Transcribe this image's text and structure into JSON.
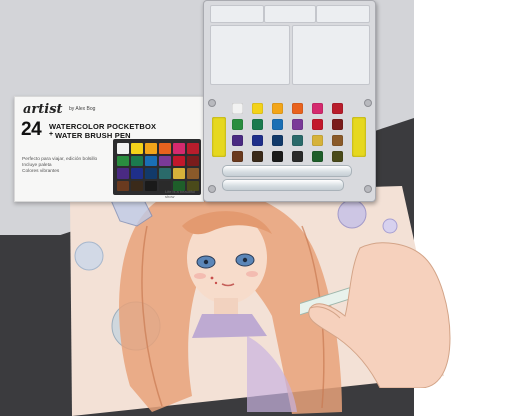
{
  "brand": {
    "logo_text": "artist",
    "byline": "by Alex Bog"
  },
  "product": {
    "count": "24",
    "title_line_1": "WATERCOLOR POCKETBOX",
    "plus": "+",
    "title_line_2": "WATER BRUSH PEN",
    "features": [
      "Perfecto para viajar, edición bolsillo",
      "Incluye paleta",
      "Colores vibrantes"
    ],
    "caption": "Life is a beautiful show"
  },
  "palette": {
    "pan_colors": [
      "#f2f2f2",
      "#f3d21a",
      "#f2a51a",
      "#e8621e",
      "#d42a6e",
      "#b81d2c",
      "#2a8d3f",
      "#1b7a4e",
      "#1a6fb5",
      "#7a3a98",
      "#c2182b",
      "#7a1c1c",
      "#4a2a82",
      "#1f2f8a",
      "#123a6a",
      "#2a6a6a",
      "#d6b23a",
      "#8a5a2a",
      "#6a3a1f",
      "#3a2a1a",
      "#1a1a1a",
      "#2a2a2a",
      "#1e5e2a",
      "#4a4a1a"
    ],
    "side_pan_color": "#e6d81f"
  },
  "colors": {
    "backdrop_light": "#d3d4d8",
    "backdrop_dark": "#3b3b3e",
    "paper": "#f3e1d6",
    "hair": "#e7a27a"
  }
}
